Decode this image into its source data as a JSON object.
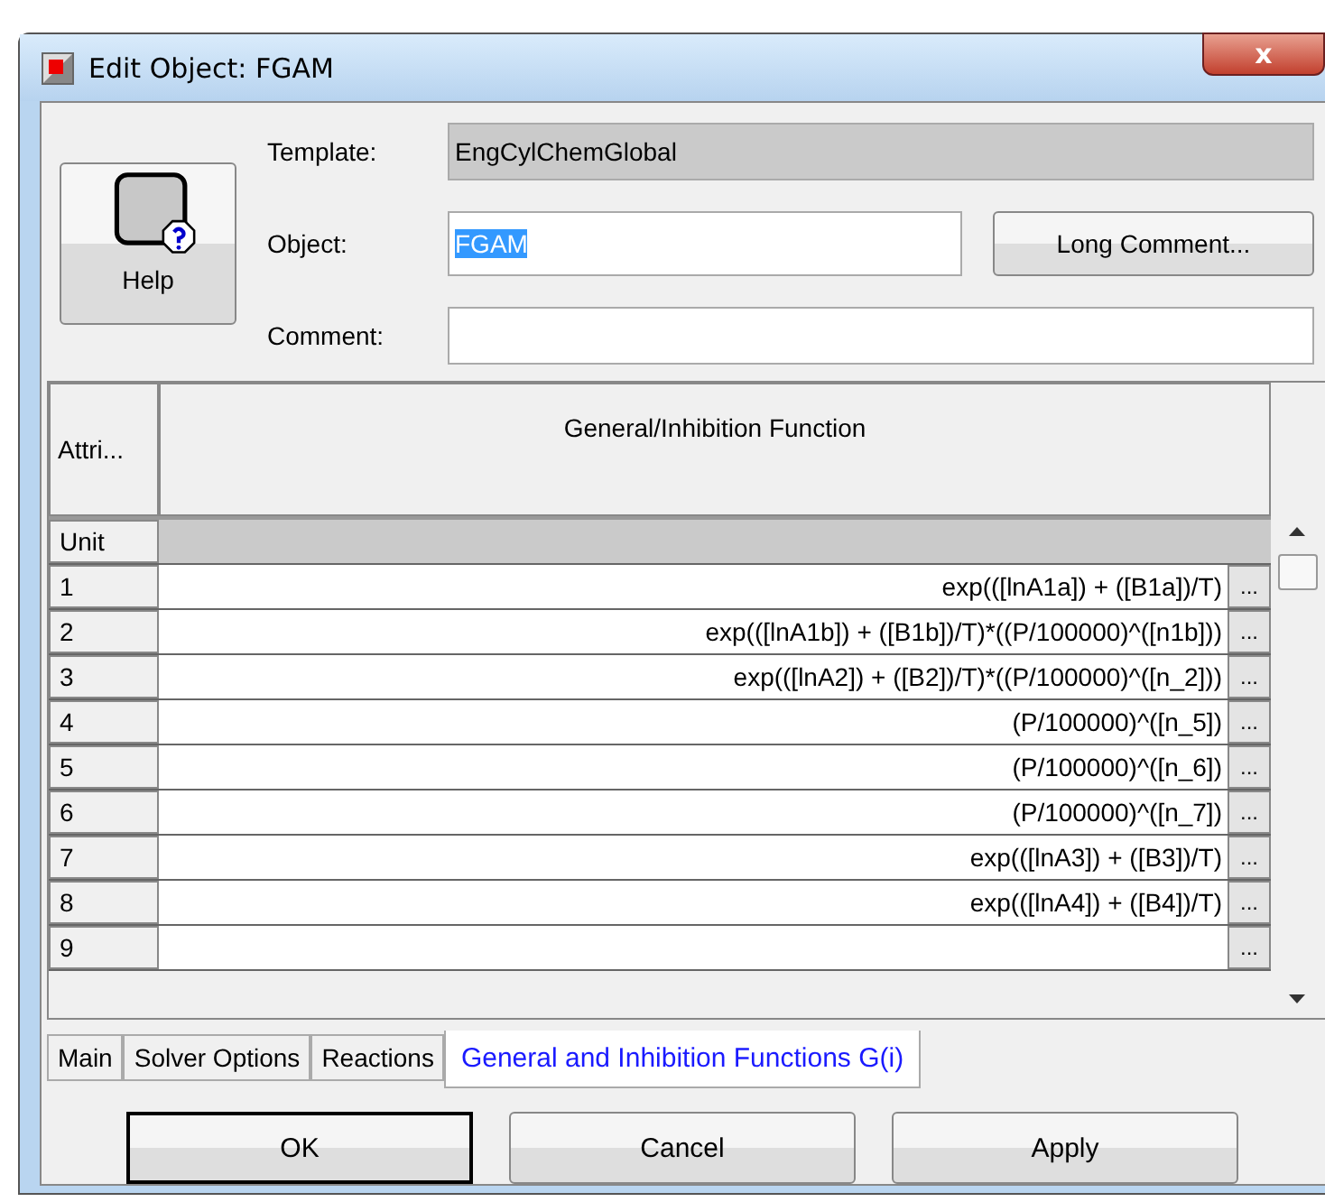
{
  "window": {
    "title": "Edit Object: FGAM",
    "close": "x"
  },
  "help": {
    "label": "Help"
  },
  "form": {
    "template_label": "Template:",
    "template_value": "EngCylChemGlobal",
    "object_label": "Object:",
    "object_value": "FGAM",
    "object_value_selected": true,
    "long_comment_button": "Long Comment...",
    "comment_label": "Comment:"
  },
  "table": {
    "columns": [
      "Attri...",
      "General/Inhibition Function"
    ],
    "unit_label": "Unit",
    "rows": [
      {
        "number": "1",
        "value": "exp(([lnA1a]) + ([B1a])/T)",
        "more": "..."
      },
      {
        "number": "2",
        "value": "exp(([lnA1b]) + ([B1b])/T)*((P/100000)^([n1b]))",
        "more": "..."
      },
      {
        "number": "3",
        "value": "exp(([lnA2]) + ([B2])/T)*((P/100000)^([n_2]))",
        "more": "..."
      },
      {
        "number": "4",
        "value": "(P/100000)^([n_5])",
        "more": "..."
      },
      {
        "number": "5",
        "value": "(P/100000)^([n_6])",
        "more": "..."
      },
      {
        "number": "6",
        "value": "(P/100000)^([n_7])",
        "more": "..."
      },
      {
        "number": "7",
        "value": "exp(([lnA3]) + ([B3])/T)",
        "more": "..."
      },
      {
        "number": "8",
        "value": "exp(([lnA4]) + ([B4])/T)",
        "more": "..."
      },
      {
        "number": "9",
        "value": "",
        "more": "..."
      }
    ]
  },
  "tabs": [
    {
      "label": "Main",
      "selected": false
    },
    {
      "label": "Solver Options",
      "selected": false
    },
    {
      "label": "Reactions",
      "selected": false
    },
    {
      "label": "General and Inhibition Functions G(i)",
      "selected": true
    }
  ],
  "buttons": [
    {
      "label": "OK",
      "default": true
    },
    {
      "label": "Cancel",
      "default": false
    },
    {
      "label": "Apply",
      "default": false
    }
  ]
}
